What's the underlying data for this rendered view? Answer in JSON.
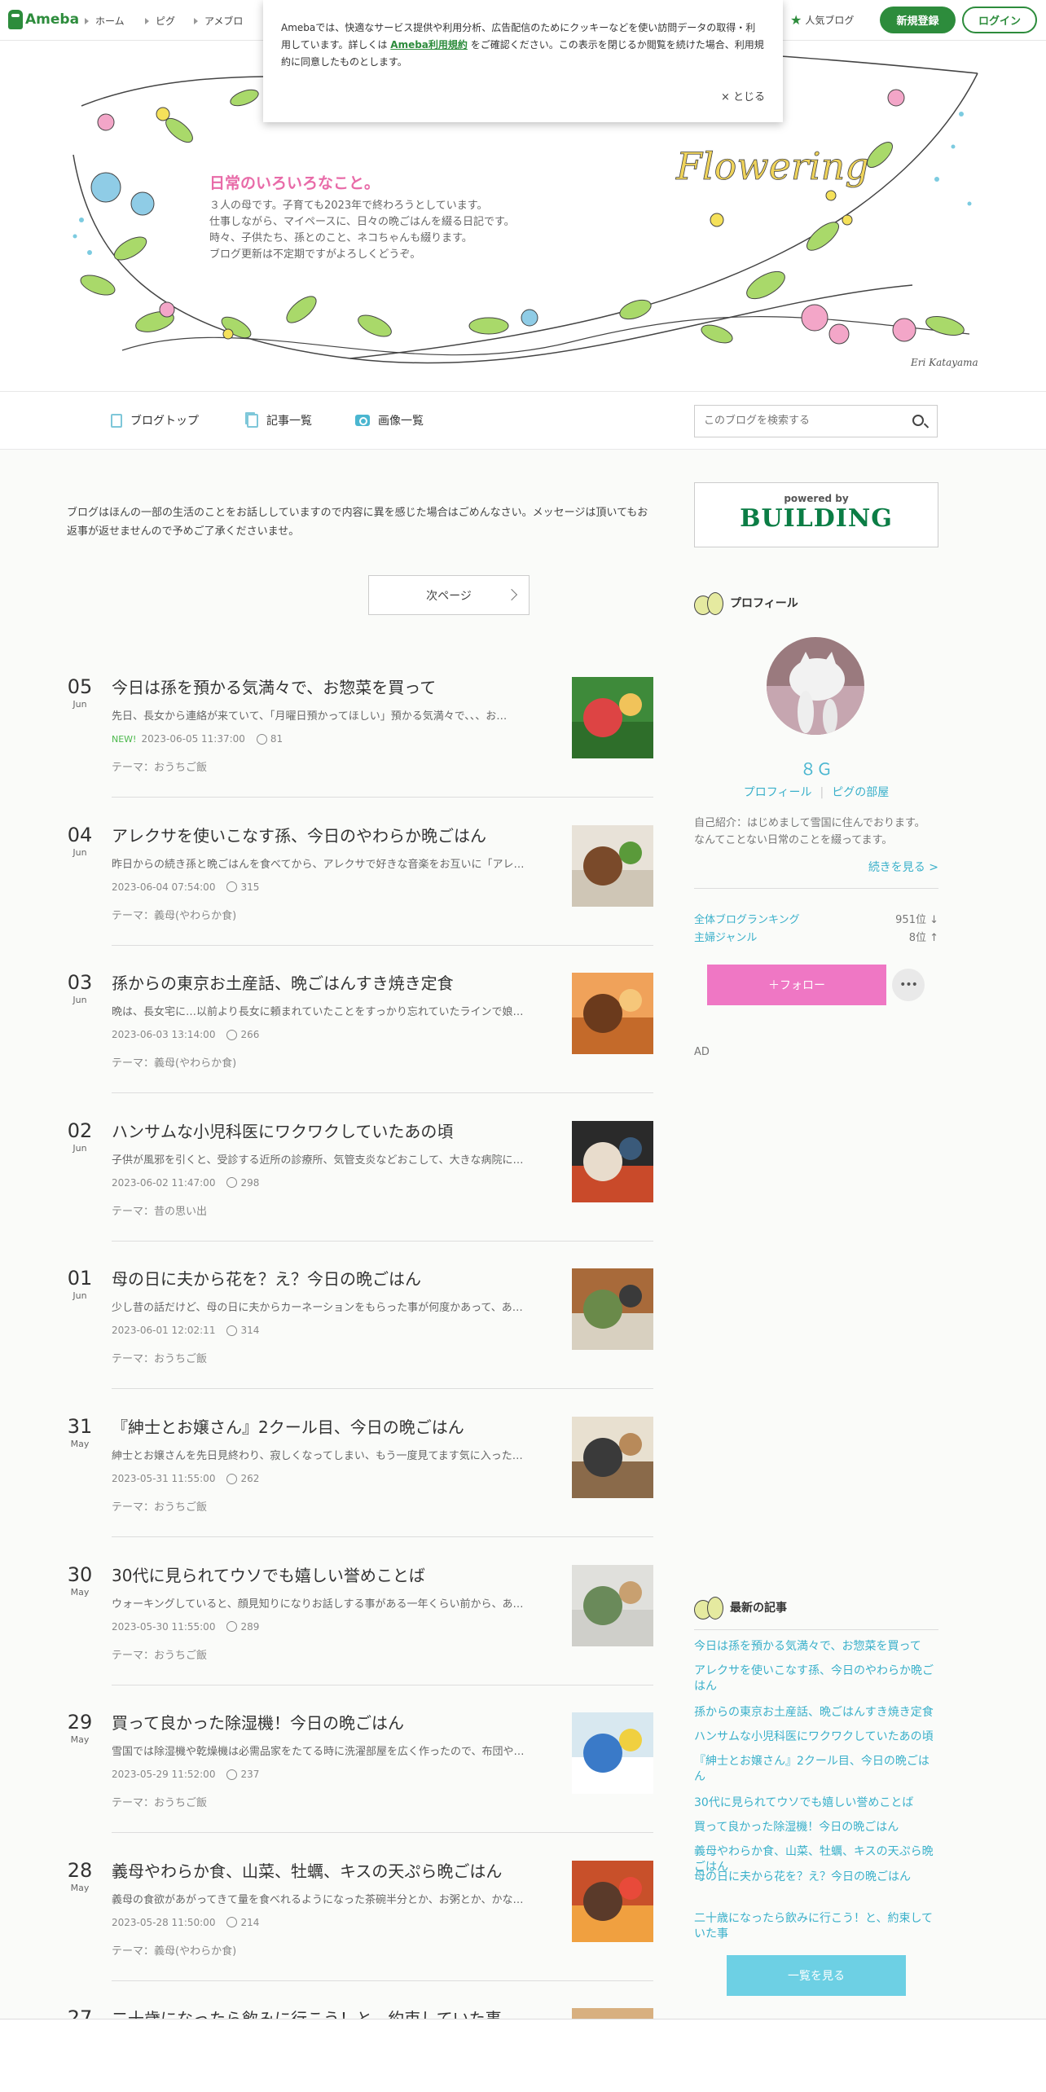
{
  "nav": {
    "logo": "Ameba",
    "links": [
      "ホーム",
      "ピグ",
      "アメブロ"
    ],
    "popular_blog": "人気ブログ",
    "register": "新規登録",
    "login": "ログイン"
  },
  "cookie": {
    "text_before": "Amebaでは、快適なサービス提供や利用分析、広告配信のためにクッキーなどを使い訪問データの取得・利用しています。詳しくは",
    "link": "Ameba利用規約",
    "text_after": "をご確認ください。この表示を閉じるか閲覧を続けた場合、利用規約に同意したものとします。",
    "close": "× とじる"
  },
  "header": {
    "title": "日常のいろいろなこと。",
    "description": "３人の母です。子育ても2023年で終わろうとしています。\n仕事しながら、マイペースに、日々の晩ごはんを綴る日記です。\n時々、子供たち、孫とのこと、ネコちゃんも綴ります。\nブログ更新は不定期ですがよろしくどうぞ。",
    "art_text": "Flowering",
    "credit": "Eri Katayama"
  },
  "subnav": {
    "top": "ブログトップ",
    "articles": "記事一覧",
    "images": "画像一覧",
    "search_placeholder": "このブログを検索する"
  },
  "main": {
    "notice": "ブログはほんの一部の生活のことをお話ししていますので内容に異を感じた場合はごめんなさい。メッセージは頂いてもお返事が返せませんので予めご了承くださいませ。",
    "next_page": "次ページ",
    "entries": [
      {
        "day": "05",
        "month": "Jun",
        "title": "今日は孫を預かる気満々で、お惣菜を買って",
        "excerpt": "先日、長女から連絡が来ていて、「月曜日預かってほしい」預かる気満々で、、、お…",
        "new": "NEW!",
        "date": "2023-06-05 11:37:00",
        "likes": "81",
        "theme": "テーマ：おうちご飯"
      },
      {
        "day": "04",
        "month": "Jun",
        "title": "アレクサを使いこなす孫、今日のやわらか晩ごはん",
        "excerpt": "昨日からの続き孫と晩ごはんを食べてから、アレクサで好きな音楽をお互いに「アレ…",
        "new": "",
        "date": "2023-06-04 07:54:00",
        "likes": "315",
        "theme": "テーマ：義母(やわらか食)"
      },
      {
        "day": "03",
        "month": "Jun",
        "title": "孫からの東京お土産話、晩ごはんすき焼き定食",
        "excerpt": "晩は、長女宅に…以前より長女に頼まれていたことをすっかり忘れていたラインで娘…",
        "new": "",
        "date": "2023-06-03 13:14:00",
        "likes": "266",
        "theme": "テーマ：義母(やわらか食)"
      },
      {
        "day": "02",
        "month": "Jun",
        "title": "ハンサムな小児科医にワクワクしていたあの頃",
        "excerpt": "子供が風邪を引くと、受診する近所の診療所、気管支炎などおこして、大きな病院に…",
        "new": "",
        "date": "2023-06-02 11:47:00",
        "likes": "298",
        "theme": "テーマ：昔の思い出"
      },
      {
        "day": "01",
        "month": "Jun",
        "title": "母の日に夫から花を？え？今日の晩ごはん",
        "excerpt": "少し昔の話だけど、母の日に夫からカーネーションをもらった事が何度かあって、あ…",
        "new": "",
        "date": "2023-06-01 12:02:11",
        "likes": "314",
        "theme": "テーマ：おうちご飯"
      },
      {
        "day": "31",
        "month": "May",
        "title": "『紳士とお嬢さん』2クール目、今日の晩ごはん",
        "excerpt": "紳士とお嬢さんを先日見終わり、寂しくなってしまい、もう一度見てます気に入った…",
        "new": "",
        "date": "2023-05-31 11:55:00",
        "likes": "262",
        "theme": "テーマ：おうちご飯"
      },
      {
        "day": "30",
        "month": "May",
        "title": "30代に見られてウソでも嬉しい誉めことば",
        "excerpt": "ウォーキングしていると、顔見知りになりお話しする事がある一年くらい前から、あ…",
        "new": "",
        "date": "2023-05-30 11:55:00",
        "likes": "289",
        "theme": "テーマ：おうちご飯"
      },
      {
        "day": "29",
        "month": "May",
        "title": "買って良かった除湿機！今日の晩ごはん",
        "excerpt": "雪国では除湿機や乾燥機は必需品家をたてる時に洗濯部屋を広く作ったので、布団や…",
        "new": "",
        "date": "2023-05-29 11:52:00",
        "likes": "237",
        "theme": "テーマ：おうちご飯"
      },
      {
        "day": "28",
        "month": "May",
        "title": "義母やわらか食、山菜、牡蠣、キスの天ぷら晩ごはん",
        "excerpt": "義母の食欲があがってきて量を食べれるようになった茶碗半分とか、お粥とか、かな…",
        "new": "",
        "date": "2023-05-28 11:50:00",
        "likes": "214",
        "theme": "テーマ：義母(やわらか食)"
      },
      {
        "day": "27",
        "month": "",
        "title": "二十歳になったら飲みに行こう！と、約束していた事",
        "excerpt": "",
        "new": "",
        "date": "",
        "likes": "",
        "theme": ""
      }
    ]
  },
  "sidebar": {
    "ad_powered": "powered by",
    "ad_brand": "BUILDING",
    "profile_heading": "プロフィール",
    "profile_name": "８Ｇ",
    "profile_link": "プロフィール",
    "pig_link": "ピグの部屋",
    "intro": "自己紹介：はじめまして雪国に住んでおります。 なんてことない日常のことを綴ってます。",
    "read_more": "続きを見る >",
    "ranking": [
      {
        "label": "全体ブログランキング",
        "value": "951位 ↓"
      },
      {
        "label": "主婦ジャンル",
        "value": "8位 ↑"
      }
    ],
    "follow": "＋フォロー",
    "more": "•••",
    "ad_label": "AD",
    "recent_heading": "最新の記事",
    "recent": [
      "今日は孫を預かる気満々で、お惣菜を買って",
      "アレクサを使いこなす孫、今日のやわらか晩ごはん",
      "孫からの東京お土産話、晩ごはんすき焼き定食",
      "ハンサムな小児科医にワクワクしていたあの頃",
      "『紳士とお嬢さん』2クール目、今日の晩ごはん",
      "30代に見られてウソでも嬉しい誉めことば",
      "買って良かった除湿機！今日の晩ごはん",
      "義母やわらか食、山菜、牡蠣、キスの天ぷら晩ごはん",
      "母の日に夫から花を？え？今日の晩ごはん",
      "二十歳になったら飲みに行こう！と、約束していた事"
    ],
    "list_button": "一覧を見る"
  },
  "colors": {
    "brand": "#2d8c3c",
    "link": "#3ab0ca",
    "follow": "#ef77c4",
    "title_pink": "#e86ba8"
  }
}
